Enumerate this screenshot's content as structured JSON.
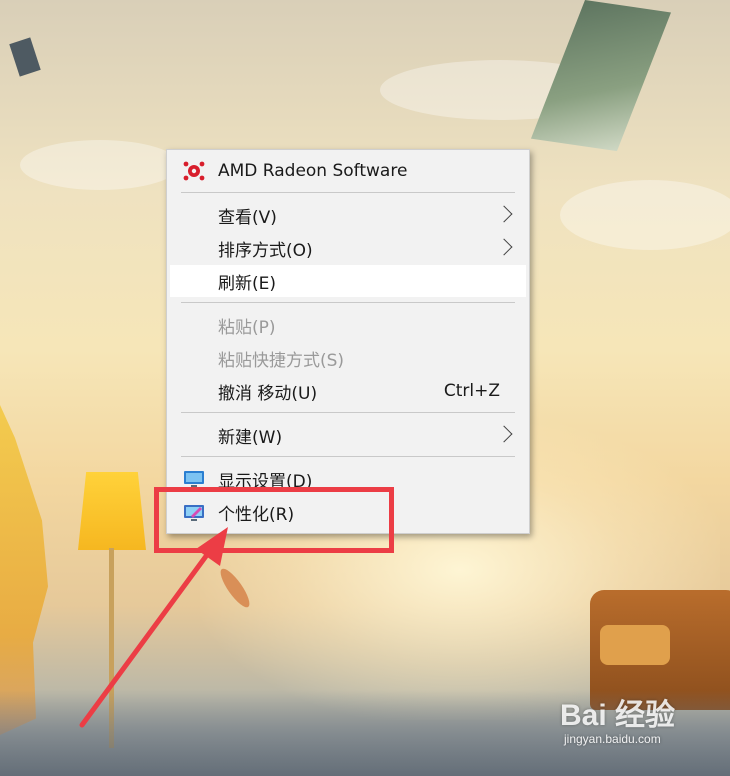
{
  "context_menu": {
    "items": [
      {
        "label": "AMD Radeon Software",
        "icon": "amd-radeon-icon"
      },
      {
        "label": "查看(V)",
        "submenu": true
      },
      {
        "label": "排序方式(O)",
        "submenu": true
      },
      {
        "label": "刷新(E)",
        "highlighted": true
      },
      {
        "label": "粘贴(P)",
        "disabled": true
      },
      {
        "label": "粘贴快捷方式(S)",
        "disabled": true
      },
      {
        "label": "撤消 移动(U)",
        "shortcut": "Ctrl+Z"
      },
      {
        "label": "新建(W)",
        "submenu": true
      },
      {
        "label": "显示设置(D)",
        "icon": "display-settings-icon"
      },
      {
        "label": "个性化(R)",
        "icon": "personalize-icon"
      }
    ]
  },
  "annotation": {
    "color": "#ec3d45",
    "target": "个性化(R)"
  },
  "watermark": {
    "brand": "Bai 经验",
    "url": "jingyan.baidu.com"
  },
  "colors": {
    "menu_background": "#f2f2f2",
    "disabled_text": "#9a9a9a",
    "amd_red": "#d81e2c"
  }
}
